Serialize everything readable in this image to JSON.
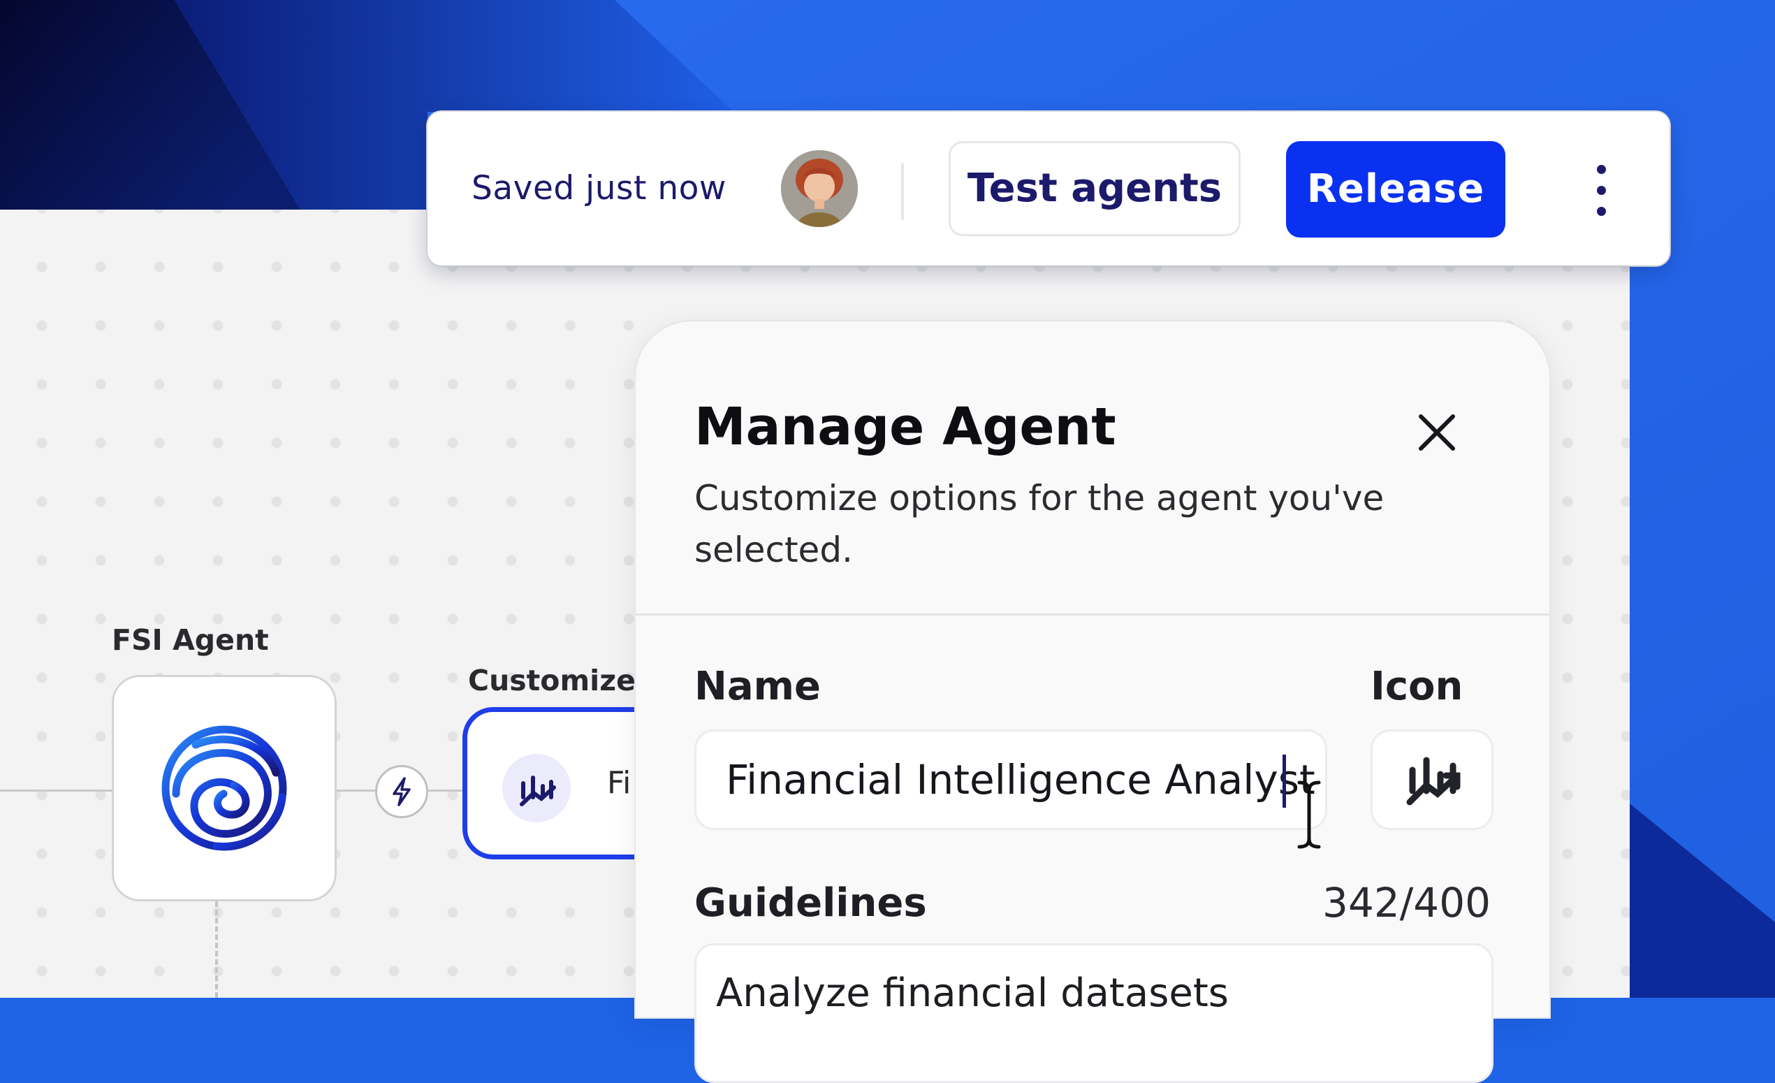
{
  "toolbar": {
    "saved_status": "Saved just now",
    "test_label": "Test agents",
    "release_label": "Release"
  },
  "canvas": {
    "agent_label": "FSI Agent",
    "customized_label": "Customized",
    "customized_card_text": "Fi"
  },
  "panel": {
    "title": "Manage Agent",
    "subtitle": "Customize options for the agent you've selected.",
    "name_label": "Name",
    "name_value": "Financial Intelligence Analyst",
    "icon_label": "Icon",
    "guidelines_label": "Guidelines",
    "guidelines_counter": "342/400",
    "guidelines_value": "Analyze financial datasets"
  },
  "colors": {
    "brand_blue": "#0a31f0",
    "text_navy": "#1b1a6b",
    "accent_blue": "#1f3ee8"
  }
}
